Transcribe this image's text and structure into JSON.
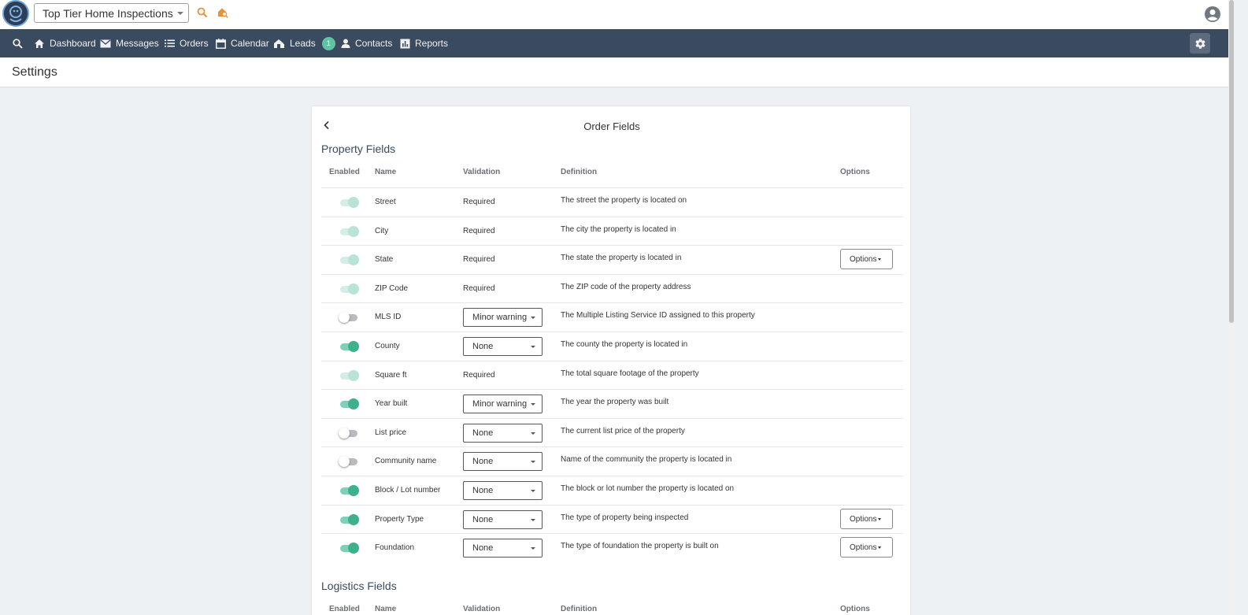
{
  "header": {
    "company": "Top Tier Home Inspections"
  },
  "nav": {
    "items": [
      {
        "label": "Dashboard",
        "icon": "home-icon"
      },
      {
        "label": "Messages",
        "icon": "mail-icon"
      },
      {
        "label": "Orders",
        "icon": "list-icon"
      },
      {
        "label": "Calendar",
        "icon": "calendar-icon"
      },
      {
        "label": "Leads",
        "icon": "leads-icon",
        "badge": "1"
      },
      {
        "label": "Contacts",
        "icon": "person-icon"
      },
      {
        "label": "Reports",
        "icon": "chart-icon"
      }
    ]
  },
  "page": {
    "title": "Settings"
  },
  "card": {
    "title": "Order Fields",
    "property_section": "Property Fields",
    "logistics_section": "Logistics Fields",
    "columns": {
      "enabled": "Enabled",
      "name": "Name",
      "validation": "Validation",
      "definition": "Definition",
      "options": "Options"
    },
    "options_button_label": "Options",
    "rows": [
      {
        "toggle": "disabled-on",
        "name": "Street",
        "validation": "Required",
        "validation_type": "text",
        "definition": "The street the property is located on",
        "has_options": false
      },
      {
        "toggle": "disabled-on",
        "name": "City",
        "validation": "Required",
        "validation_type": "text",
        "definition": "The city the property is located in",
        "has_options": false
      },
      {
        "toggle": "disabled-on",
        "name": "State",
        "validation": "Required",
        "validation_type": "text",
        "definition": "The state the property is located in",
        "has_options": true
      },
      {
        "toggle": "disabled-on",
        "name": "ZIP Code",
        "validation": "Required",
        "validation_type": "text",
        "definition": "The ZIP code of the property address",
        "has_options": false
      },
      {
        "toggle": "off",
        "name": "MLS ID",
        "validation": "Minor warning",
        "validation_type": "select",
        "definition": "The Multiple Listing Service ID assigned to this property",
        "has_options": false
      },
      {
        "toggle": "on",
        "name": "County",
        "validation": "None",
        "validation_type": "select",
        "definition": "The county the property is located in",
        "has_options": false
      },
      {
        "toggle": "disabled-on",
        "name": "Square ft",
        "validation": "Required",
        "validation_type": "text",
        "definition": "The total square footage of the property",
        "has_options": false
      },
      {
        "toggle": "on",
        "name": "Year built",
        "validation": "Minor warning",
        "validation_type": "select",
        "definition": "The year the property was built",
        "has_options": false
      },
      {
        "toggle": "off",
        "name": "List price",
        "validation": "None",
        "validation_type": "select",
        "definition": "The current list price of the property",
        "has_options": false
      },
      {
        "toggle": "off",
        "name": "Community name",
        "validation": "None",
        "validation_type": "select",
        "definition": "Name of the community the property is located in",
        "has_options": false
      },
      {
        "toggle": "on",
        "name": "Block / Lot number",
        "validation": "None",
        "validation_type": "select",
        "definition": "The block or lot number the property is located on",
        "has_options": false
      },
      {
        "toggle": "on",
        "name": "Property Type",
        "validation": "None",
        "validation_type": "select",
        "definition": "The type of property being inspected",
        "has_options": true
      },
      {
        "toggle": "on",
        "name": "Foundation",
        "validation": "None",
        "validation_type": "select",
        "definition": "The type of foundation the property is built on",
        "has_options": true
      }
    ]
  },
  "colors": {
    "navbar": "#3a4a5f",
    "accent_orange": "#e8923a",
    "toggle_on": "#3fb08c",
    "badge": "#5fc3a4"
  }
}
